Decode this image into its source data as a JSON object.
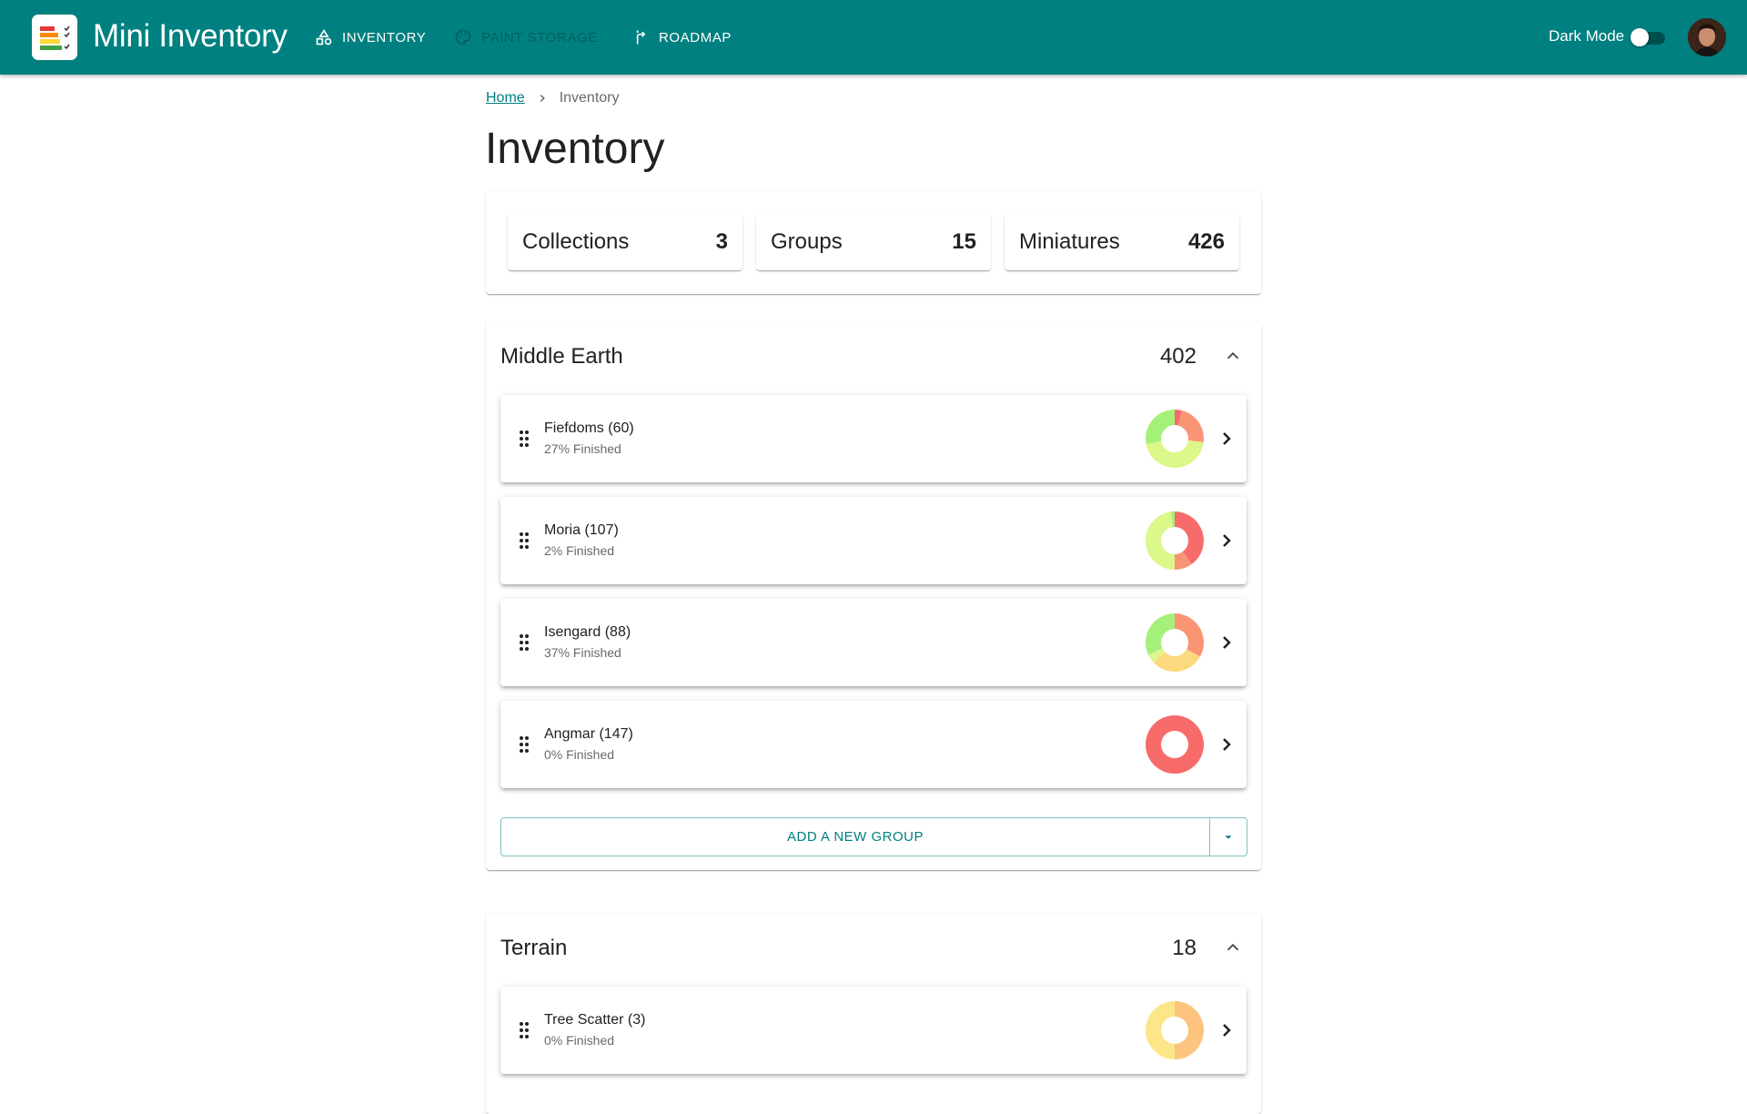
{
  "app": {
    "title": "Mini Inventory",
    "nav": [
      {
        "label": "INVENTORY",
        "icon": "shapes-icon",
        "disabled": false
      },
      {
        "label": "PAINT STORAGE",
        "icon": "palette-icon",
        "disabled": true
      },
      {
        "label": "ROADMAP",
        "icon": "road-icon",
        "disabled": false
      }
    ],
    "dark_mode_label": "Dark Mode",
    "dark_mode_on": false
  },
  "breadcrumb": {
    "home": "Home",
    "current": "Inventory"
  },
  "page_title": "Inventory",
  "stats": [
    {
      "label": "Collections",
      "value": "3"
    },
    {
      "label": "Groups",
      "value": "15"
    },
    {
      "label": "Miniatures",
      "value": "426"
    }
  ],
  "collections": [
    {
      "name": "Middle Earth",
      "count": "402",
      "groups": [
        {
          "title": "Fiefdoms (60)",
          "subtitle": "27% Finished",
          "slices": [
            {
              "v": 0.04,
              "c": "#f76b6b"
            },
            {
              "v": 0.23,
              "c": "#f99574"
            },
            {
              "v": 0.45,
              "c": "#dcf78a"
            },
            {
              "v": 0.28,
              "c": "#a5f078"
            }
          ]
        },
        {
          "title": "Moria (107)",
          "subtitle": "2% Finished",
          "slices": [
            {
              "v": 0.4,
              "c": "#f76b6b"
            },
            {
              "v": 0.1,
              "c": "#f99574"
            },
            {
              "v": 0.48,
              "c": "#dcf78a"
            },
            {
              "v": 0.02,
              "c": "#a5f078"
            }
          ]
        },
        {
          "title": "Isengard (88)",
          "subtitle": "37% Finished",
          "slices": [
            {
              "v": 0.33,
              "c": "#f99574"
            },
            {
              "v": 0.3,
              "c": "#fcd97e"
            },
            {
              "v": 0.05,
              "c": "#dcf78a"
            },
            {
              "v": 0.32,
              "c": "#a5f078"
            }
          ]
        },
        {
          "title": "Angmar (147)",
          "subtitle": "0% Finished",
          "slices": [
            {
              "v": 1.0,
              "c": "#f76b6b"
            }
          ]
        }
      ],
      "add_label": "ADD A NEW GROUP"
    },
    {
      "name": "Terrain",
      "count": "18",
      "groups": [
        {
          "title": "Tree Scatter (3)",
          "subtitle": "0% Finished",
          "slices": [
            {
              "v": 0.5,
              "c": "#fcc47e"
            },
            {
              "v": 0.5,
              "c": "#fde68a"
            }
          ]
        }
      ]
    }
  ],
  "colors": {
    "primary": "#008080"
  }
}
